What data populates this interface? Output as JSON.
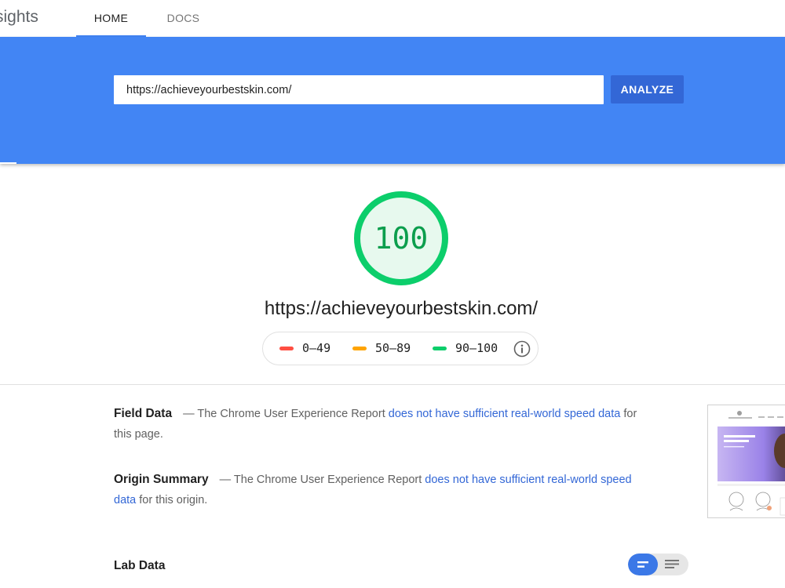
{
  "header": {
    "brand": "sights",
    "tabs": [
      {
        "label": "HOME",
        "active": true
      },
      {
        "label": "DOCS",
        "active": false
      }
    ]
  },
  "search": {
    "url_value": "https://achieveyourbestskin.com/",
    "button_label": "ANALYZE"
  },
  "score": {
    "value": "100",
    "fraction": 1.0,
    "color": "#0cce6b",
    "tested_url": "https://achieveyourbestskin.com/"
  },
  "legend": {
    "items": [
      {
        "label": "0–49",
        "color": "#ff4e42"
      },
      {
        "label": "50–89",
        "color": "#ffa400"
      },
      {
        "label": "90–100",
        "color": "#0cce6b"
      }
    ],
    "info_icon": "info-icon"
  },
  "field_data": {
    "title": "Field Data",
    "prefix": "— The Chrome User Experience Report",
    "link": "does not have sufficient real-world speed data",
    "suffix": "for this page."
  },
  "origin_summary": {
    "title": "Origin Summary",
    "prefix": "— The Chrome User Experience Report",
    "link": "does not have sufficient real-world speed data",
    "suffix": "for this origin."
  },
  "lab_data": {
    "title": "Lab Data"
  },
  "colors": {
    "banner": "#4285f4",
    "button": "#3367d6",
    "link": "#3367d6"
  },
  "icons": [
    "info-icon",
    "summary-view-icon",
    "list-view-icon"
  ]
}
